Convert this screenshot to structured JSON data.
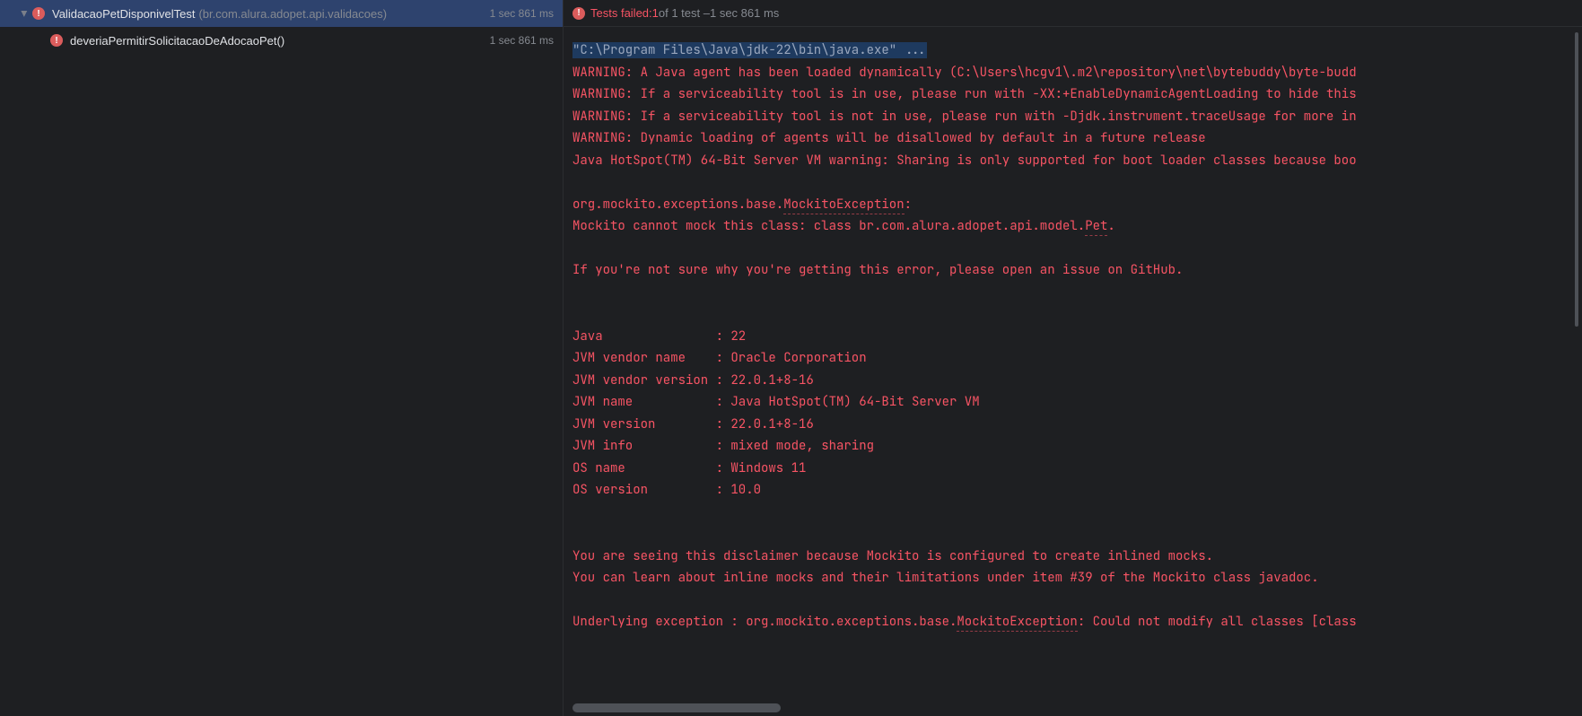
{
  "tree": {
    "class_name": "ValidacaoPetDisponivelTest",
    "class_pkg": "(br.com.alura.adopet.api.validacoes)",
    "class_time": "1 sec 861 ms",
    "method_name": "deveriaPermitirSolicitacaoDeAdocaoPet()",
    "method_time": "1 sec 861 ms"
  },
  "status": {
    "prefix": "Tests failed: ",
    "count": "1",
    "mid": " of 1 test – ",
    "time": "1 sec 861 ms"
  },
  "console": {
    "cmd": "\"C:\\Program Files\\Java\\jdk-22\\bin\\java.exe\" ...",
    "w1": "WARNING: A Java agent has been loaded dynamically (C:\\Users\\hcgv1\\.m2\\repository\\net\\bytebuddy\\byte-budd",
    "w2": "WARNING: If a serviceability tool is in use, please run with -XX:+EnableDynamicAgentLoading to hide this",
    "w3": "WARNING: If a serviceability tool is not in use, please run with -Djdk.instrument.traceUsage for more in",
    "w4": "WARNING: Dynamic loading of agents will be disallowed by default in a future release",
    "w5": "Java HotSpot(TM) 64-Bit Server VM warning: Sharing is only supported for boot loader classes because boo",
    "ex_pre": "org.mockito.exceptions.base.",
    "ex_cls": "MockitoException",
    "ex_colon": ": ",
    "mock_pre": "Mockito cannot mock this class: class br.com.alura.adopet.api.model.",
    "mock_cls": "Pet",
    "mock_dot": ".",
    "note": "If you're not sure why you're getting this error, please open an issue on GitHub.",
    "env1": "Java               : 22",
    "env2": "JVM vendor name    : Oracle Corporation",
    "env3": "JVM vendor version : 22.0.1+8-16",
    "env4": "JVM name           : Java HotSpot(TM) 64-Bit Server VM",
    "env5": "JVM version        : 22.0.1+8-16",
    "env6": "JVM info           : mixed mode, sharing",
    "env7": "OS name            : Windows 11",
    "env8": "OS version         : 10.0",
    "d1": "You are seeing this disclaimer because Mockito is configured to create inlined mocks.",
    "d2": "You can learn about inline mocks and their limitations under item #39 of the Mockito class javadoc.",
    "u_pre": "Underlying exception : org.mockito.exceptions.base.",
    "u_cls": "MockitoException",
    "u_post": ": Could not modify all classes [class"
  }
}
